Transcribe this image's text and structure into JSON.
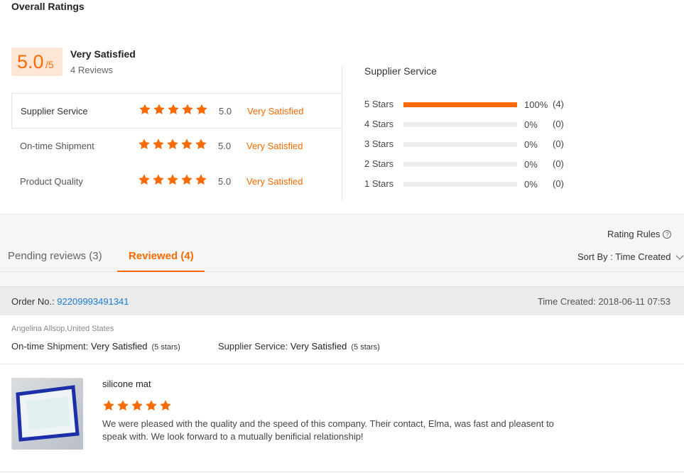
{
  "header": {
    "title": "Overall Ratings"
  },
  "summary": {
    "score": "5.0",
    "score_denominator": "/5",
    "label": "Very Satisfied",
    "reviews_count": "4 Reviews"
  },
  "ratings": [
    {
      "label": "Supplier Service",
      "stars": 5,
      "score": "5.0",
      "text": "Very Satisfied"
    },
    {
      "label": "On-time Shipment",
      "stars": 5,
      "score": "5.0",
      "text": "Very Satisfied"
    },
    {
      "label": "Product Quality",
      "stars": 5,
      "score": "5.0",
      "text": "Very Satisfied"
    }
  ],
  "distribution": {
    "title": "Supplier Service",
    "rows": [
      {
        "label": "5 Stars",
        "fraction": 1.0,
        "pct": "100%",
        "count": "(4)"
      },
      {
        "label": "4 Stars",
        "fraction": 0.0,
        "pct": "0%",
        "count": "(0)"
      },
      {
        "label": "3 Stars",
        "fraction": 0.0,
        "pct": "0%",
        "count": "(0)"
      },
      {
        "label": "2 Stars",
        "fraction": 0.0,
        "pct": "0%",
        "count": "(0)"
      },
      {
        "label": "1 Stars",
        "fraction": 0.0,
        "pct": "0%",
        "count": "(0)"
      }
    ]
  },
  "toolbar": {
    "rating_rules": "Rating Rules",
    "help_icon": "?",
    "sort_by": "Sort By : Time Created"
  },
  "tabs": [
    {
      "label": "Pending reviews (3)",
      "active": false
    },
    {
      "label": "Reviewed (4)",
      "active": true
    }
  ],
  "order": {
    "label": "Order No.: ",
    "number": "92209993491341",
    "time_created": "Time Created: 2018-06-11 07:53"
  },
  "review": {
    "reviewer": "Angelina Allsop,United States",
    "shipment_label": "On-time Shipment: ",
    "shipment_value": "Very Satisfied",
    "shipment_stars": "(5 stars)",
    "service_label": "Supplier Service: ",
    "service_value": "Very Satisfied",
    "service_stars": "(5 stars)",
    "product_name": "silicone mat",
    "stars": 5,
    "text": "We were pleased with the quality and the speed of this company. Their contact, Elma, was fast and pleasent to speak with. We look forward to a mutually benificial relationship!"
  },
  "colors": {
    "accent": "#ff6a00",
    "link": "#1a7bd6",
    "score_bg": "#fde6d6"
  }
}
